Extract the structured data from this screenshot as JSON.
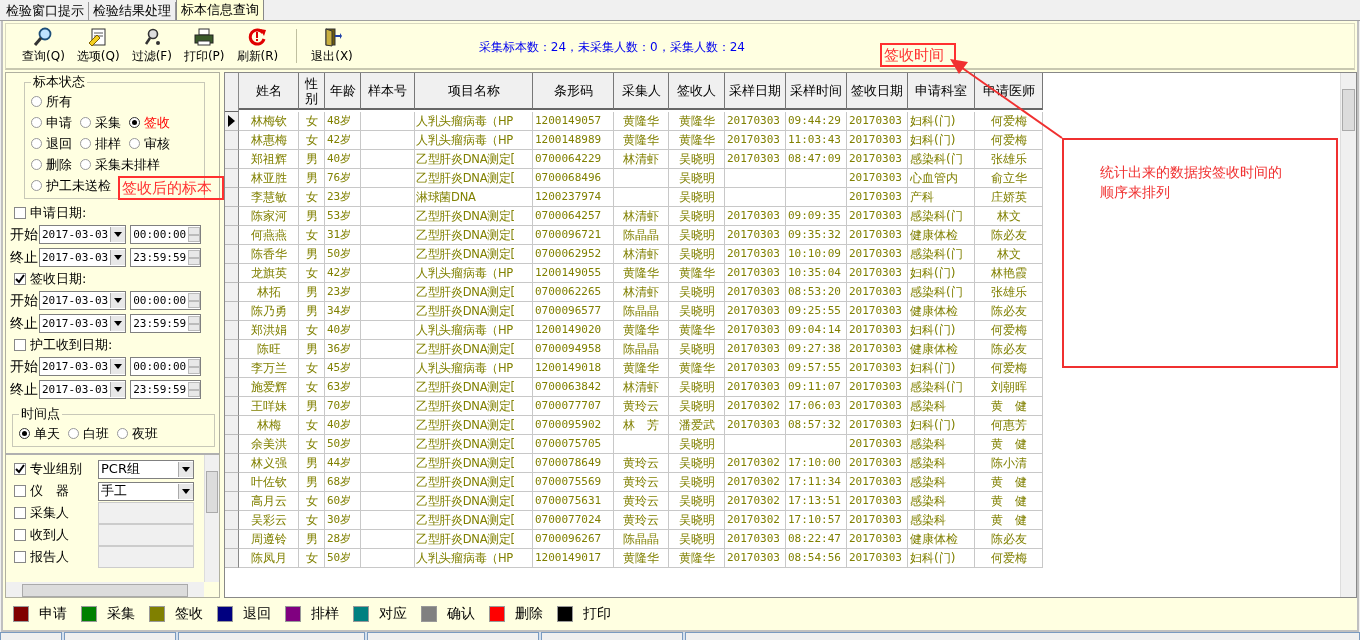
{
  "tabs": [
    {
      "label": "检验窗口提示",
      "selected": false
    },
    {
      "label": "检验结果处理",
      "selected": false
    },
    {
      "label": "标本信息查询",
      "selected": true
    }
  ],
  "toolbar": [
    {
      "kind": "search",
      "label": "查询(Q)"
    },
    {
      "kind": "options",
      "label": "选项(Q)"
    },
    {
      "kind": "filter",
      "label": "过滤(F)"
    },
    {
      "kind": "print",
      "label": "打印(P)"
    },
    {
      "kind": "refresh",
      "label": "刷新(R)"
    },
    {
      "kind": "exit",
      "label": "退出(X)"
    }
  ],
  "summary": "采集标本数：24，未采集人数：0，采集人数：24",
  "status_filter": {
    "legend": "标本状态",
    "rows": [
      [
        {
          "label": "所有",
          "selected": false
        }
      ],
      [
        {
          "label": "申请",
          "selected": false
        },
        {
          "label": "采集",
          "selected": false
        },
        {
          "label": "签收",
          "selected": true
        }
      ],
      [
        {
          "label": "退回",
          "selected": false
        },
        {
          "label": "排样",
          "selected": false
        },
        {
          "label": "审核",
          "selected": false
        }
      ],
      [
        {
          "label": "删除",
          "selected": false
        },
        {
          "label": "采集未排样",
          "selected": false
        }
      ],
      [
        {
          "label": "护工未送检",
          "selected": false
        }
      ]
    ]
  },
  "date_filters": [
    {
      "label": "申请日期:",
      "checked": false,
      "rows": [
        {
          "label": "开始",
          "date": "2017-03-03",
          "time": "00:00:00"
        },
        {
          "label": "终止",
          "date": "2017-03-03",
          "time": "23:59:59"
        }
      ]
    },
    {
      "label": "签收日期:",
      "checked": true,
      "rows": [
        {
          "label": "开始",
          "date": "2017-03-03",
          "time": "00:00:00"
        },
        {
          "label": "终止",
          "date": "2017-03-03",
          "time": "23:59:59"
        }
      ]
    },
    {
      "label": "护工收到日期:",
      "checked": false,
      "rows": [
        {
          "label": "开始",
          "date": "2017-03-03",
          "time": "00:00:00"
        },
        {
          "label": "终止",
          "date": "2017-03-03",
          "time": "23:59:59"
        }
      ]
    }
  ],
  "time_point": {
    "legend": "时间点",
    "options": [
      {
        "label": "单天",
        "selected": true
      },
      {
        "label": "白班",
        "selected": false
      },
      {
        "label": "夜班",
        "selected": false
      }
    ]
  },
  "other_filters": [
    {
      "label": "专业组别",
      "checked": true,
      "kind": "combo",
      "value": "PCR组"
    },
    {
      "label": "仪　器",
      "checked": false,
      "kind": "combo",
      "value": "手工"
    },
    {
      "label": "采集人",
      "checked": false,
      "kind": "field"
    },
    {
      "label": "收到人",
      "checked": false,
      "kind": "field"
    },
    {
      "label": "报告人",
      "checked": false,
      "kind": "field"
    }
  ],
  "table": {
    "columns": [
      "姓名",
      "性别",
      "年龄",
      "样本号",
      "项目名称",
      "条形码",
      "采集人",
      "签收人",
      "采样日期",
      "采样时间",
      "签收日期",
      "申请科室",
      "申请医师"
    ],
    "rows": [
      {
        "selected": true,
        "color": "#808000",
        "name": "林梅钦",
        "sex": "女",
        "age": "48岁",
        "item": "人乳头瘤病毒（HP",
        "barcode": "1200149057",
        "collector": "黄隆华",
        "receiver": "黄隆华",
        "sample_date": "20170303",
        "sample_time": "09:44:29",
        "sign_date": "20170303",
        "dept": "妇科(门)",
        "doctor": "何爱梅"
      },
      {
        "selected": false,
        "color": "#808000",
        "name": "林惠梅",
        "sex": "女",
        "age": "42岁",
        "item": "人乳头瘤病毒（HP",
        "barcode": "1200148989",
        "collector": "黄隆华",
        "receiver": "黄隆华",
        "sample_date": "20170303",
        "sample_time": "11:03:43",
        "sign_date": "20170303",
        "dept": "妇科(门)",
        "doctor": "何爱梅"
      },
      {
        "selected": false,
        "color": "#808000",
        "name": "郑祖辉",
        "sex": "男",
        "age": "40岁",
        "item": "乙型肝炎DNA测定[",
        "barcode": "0700064229",
        "collector": "林清虾",
        "receiver": "吴晓明",
        "sample_date": "20170303",
        "sample_time": "08:47:09",
        "sign_date": "20170303",
        "dept": "感染科(门",
        "doctor": "张雄乐"
      },
      {
        "selected": false,
        "color": "#808000",
        "name": "林亚胜",
        "sex": "男",
        "age": "76岁",
        "item": "乙型肝炎DNA测定[",
        "barcode": "0700068496",
        "receiver": "吴晓明",
        "sign_date": "20170303",
        "dept": "心血管内",
        "doctor": "俞立华"
      },
      {
        "selected": false,
        "color": "#808000",
        "name": "李慧敏",
        "sex": "女",
        "age": "23岁",
        "item": "淋球菌DNA",
        "barcode": "1200237974",
        "receiver": "吴晓明",
        "sign_date": "20170303",
        "dept": "产科",
        "doctor": "庄娇英"
      },
      {
        "selected": false,
        "color": "#808000",
        "name": "陈家河",
        "sex": "男",
        "age": "53岁",
        "item": "乙型肝炎DNA测定[",
        "barcode": "0700064257",
        "collector": "林清虾",
        "receiver": "吴晓明",
        "sample_date": "20170303",
        "sample_time": "09:09:35",
        "sign_date": "20170303",
        "dept": "感染科(门",
        "doctor": "林文"
      },
      {
        "selected": false,
        "color": "#808000",
        "name": "何燕燕",
        "sex": "女",
        "age": "31岁",
        "item": "乙型肝炎DNA测定[",
        "barcode": "0700096721",
        "collector": "陈晶晶",
        "receiver": "吴晓明",
        "sample_date": "20170303",
        "sample_time": "09:35:32",
        "sign_date": "20170303",
        "dept": "健康体检",
        "doctor": "陈必友"
      },
      {
        "selected": false,
        "color": "#808000",
        "name": "陈香华",
        "sex": "男",
        "age": "50岁",
        "item": "乙型肝炎DNA测定[",
        "barcode": "0700062952",
        "collector": "林清虾",
        "receiver": "吴晓明",
        "sample_date": "20170303",
        "sample_time": "10:10:09",
        "sign_date": "20170303",
        "dept": "感染科(门",
        "doctor": "林文"
      },
      {
        "selected": false,
        "color": "#808000",
        "name": "龙旗英",
        "sex": "女",
        "age": "42岁",
        "item": "人乳头瘤病毒（HP",
        "barcode": "1200149055",
        "collector": "黄隆华",
        "receiver": "黄隆华",
        "sample_date": "20170303",
        "sample_time": "10:35:04",
        "sign_date": "20170303",
        "dept": "妇科(门)",
        "doctor": "林艳霞"
      },
      {
        "selected": false,
        "color": "#808000",
        "name": "林拓",
        "sex": "男",
        "age": "23岁",
        "item": "乙型肝炎DNA测定[",
        "barcode": "0700062265",
        "collector": "林清虾",
        "receiver": "吴晓明",
        "sample_date": "20170303",
        "sample_time": "08:53:20",
        "sign_date": "20170303",
        "dept": "感染科(门",
        "doctor": "张雄乐"
      },
      {
        "selected": false,
        "color": "#808000",
        "name": "陈乃勇",
        "sex": "男",
        "age": "34岁",
        "item": "乙型肝炎DNA测定[",
        "barcode": "0700096577",
        "collector": "陈晶晶",
        "receiver": "吴晓明",
        "sample_date": "20170303",
        "sample_time": "09:25:55",
        "sign_date": "20170303",
        "dept": "健康体检",
        "doctor": "陈必友"
      },
      {
        "selected": false,
        "color": "#808000",
        "name": "郑洪娟",
        "sex": "女",
        "age": "40岁",
        "item": "人乳头瘤病毒（HP",
        "barcode": "1200149020",
        "collector": "黄隆华",
        "receiver": "黄隆华",
        "sample_date": "20170303",
        "sample_time": "09:04:14",
        "sign_date": "20170303",
        "dept": "妇科(门)",
        "doctor": "何爱梅"
      },
      {
        "selected": false,
        "color": "#808000",
        "name": "陈旺",
        "sex": "男",
        "age": "36岁",
        "item": "乙型肝炎DNA测定[",
        "barcode": "0700094958",
        "collector": "陈晶晶",
        "receiver": "吴晓明",
        "sample_date": "20170303",
        "sample_time": "09:27:38",
        "sign_date": "20170303",
        "dept": "健康体检",
        "doctor": "陈必友"
      },
      {
        "selected": false,
        "color": "#808000",
        "name": "李万兰",
        "sex": "女",
        "age": "45岁",
        "item": "人乳头瘤病毒（HP",
        "barcode": "1200149018",
        "collector": "黄隆华",
        "receiver": "黄隆华",
        "sample_date": "20170303",
        "sample_time": "09:57:55",
        "sign_date": "20170303",
        "dept": "妇科(门)",
        "doctor": "何爱梅"
      },
      {
        "selected": false,
        "color": "#808000",
        "name": "施爱辉",
        "sex": "女",
        "age": "63岁",
        "item": "乙型肝炎DNA测定[",
        "barcode": "0700063842",
        "collector": "林清虾",
        "receiver": "吴晓明",
        "sample_date": "20170303",
        "sample_time": "09:11:07",
        "sign_date": "20170303",
        "dept": "感染科(门",
        "doctor": "刘朝晖"
      },
      {
        "selected": false,
        "color": "#808000",
        "name": "王咩妹",
        "sex": "男",
        "age": "70岁",
        "item": "乙型肝炎DNA测定[",
        "barcode": "0700077707",
        "collector": "黄玲云",
        "receiver": "吴晓明",
        "sample_date": "20170302",
        "sample_time": "17:06:03",
        "sign_date": "20170303",
        "dept": "感染科",
        "doctor": "黄　健"
      },
      {
        "selected": false,
        "color": "#808000",
        "name": "林梅",
        "sex": "女",
        "age": "40岁",
        "item": "乙型肝炎DNA测定[",
        "barcode": "0700095902",
        "collector": "林　芳",
        "receiver": "潘爱武",
        "sample_date": "20170303",
        "sample_time": "08:57:32",
        "sign_date": "20170303",
        "dept": "妇科(门)",
        "doctor": "何惠芳"
      },
      {
        "selected": false,
        "color": "#808000",
        "name": "余美洪",
        "sex": "女",
        "age": "50岁",
        "item": "乙型肝炎DNA测定[",
        "barcode": "0700075705",
        "receiver": "吴晓明",
        "sign_date": "20170303",
        "dept": "感染科",
        "doctor": "黄　健"
      },
      {
        "selected": false,
        "color": "#808000",
        "name": "林义强",
        "sex": "男",
        "age": "44岁",
        "item": "乙型肝炎DNA测定[",
        "barcode": "0700078649",
        "collector": "黄玲云",
        "receiver": "吴晓明",
        "sample_date": "20170302",
        "sample_time": "17:10:00",
        "sign_date": "20170303",
        "dept": "感染科",
        "doctor": "陈小清"
      },
      {
        "selected": false,
        "color": "#808000",
        "name": "叶佐钦",
        "sex": "男",
        "age": "68岁",
        "item": "乙型肝炎DNA测定[",
        "barcode": "0700075569",
        "collector": "黄玲云",
        "receiver": "吴晓明",
        "sample_date": "20170302",
        "sample_time": "17:11:34",
        "sign_date": "20170303",
        "dept": "感染科",
        "doctor": "黄　健"
      },
      {
        "selected": false,
        "color": "#808000",
        "name": "高月云",
        "sex": "女",
        "age": "60岁",
        "item": "乙型肝炎DNA测定[",
        "barcode": "0700075631",
        "collector": "黄玲云",
        "receiver": "吴晓明",
        "sample_date": "20170302",
        "sample_time": "17:13:51",
        "sign_date": "20170303",
        "dept": "感染科",
        "doctor": "黄　健"
      },
      {
        "selected": false,
        "color": "#808000",
        "name": "吴彩云",
        "sex": "女",
        "age": "30岁",
        "item": "乙型肝炎DNA测定[",
        "barcode": "0700077024",
        "collector": "黄玲云",
        "receiver": "吴晓明",
        "sample_date": "20170302",
        "sample_time": "17:10:57",
        "sign_date": "20170303",
        "dept": "感染科",
        "doctor": "黄　健"
      },
      {
        "selected": false,
        "color": "#808000",
        "name": "周遵铃",
        "sex": "男",
        "age": "28岁",
        "item": "乙型肝炎DNA测定[",
        "barcode": "0700096267",
        "collector": "陈晶晶",
        "receiver": "吴晓明",
        "sample_date": "20170303",
        "sample_time": "08:22:47",
        "sign_date": "20170303",
        "dept": "健康体检",
        "doctor": "陈必友"
      },
      {
        "selected": false,
        "color": "#808000",
        "name": "陈凤月",
        "sex": "女",
        "age": "50岁",
        "item": "人乳头瘤病毒（HP",
        "barcode": "1200149017",
        "collector": "黄隆华",
        "receiver": "黄隆华",
        "sample_date": "20170303",
        "sample_time": "08:54:56",
        "sign_date": "20170303",
        "dept": "妇科(门)",
        "doctor": "何爱梅"
      }
    ]
  },
  "legend": [
    {
      "label": "申请",
      "color": "#800000"
    },
    {
      "label": "采集",
      "color": "#008000"
    },
    {
      "label": "签收",
      "color": "#808000"
    },
    {
      "label": "退回",
      "color": "#000080"
    },
    {
      "label": "排样",
      "color": "#800080"
    },
    {
      "label": "对应",
      "color": "#008080"
    },
    {
      "label": "确认",
      "color": "#808080"
    },
    {
      "label": "删除",
      "color": "#ff0000"
    },
    {
      "label": "打印",
      "color": "#000000"
    }
  ],
  "annotations": [
    {
      "kind": "label",
      "text": "签收后的标本"
    },
    {
      "kind": "label",
      "text": "签收时间"
    },
    {
      "kind": "note",
      "text": "统计出来的数据按签收时间的顺序来排列"
    }
  ]
}
